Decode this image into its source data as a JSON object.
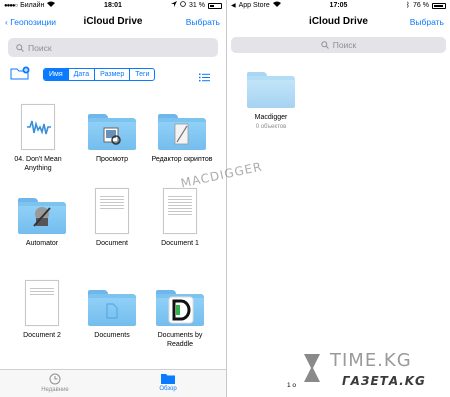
{
  "left": {
    "status": {
      "carrier": "Билайн",
      "time": "18:01",
      "battery": "31 %",
      "battery_level": 0.31
    },
    "nav": {
      "back_label": "Геопозиции",
      "title": "iCloud Drive",
      "action_label": "Выбрать"
    },
    "search": {
      "placeholder": "Поиск"
    },
    "sort": {
      "options": [
        "Имя",
        "Дата",
        "Размер",
        "Теги"
      ],
      "selected": "Имя"
    },
    "items": [
      {
        "label": "04. Don't Mean Anything",
        "kind": "audio"
      },
      {
        "label": "Просмотр",
        "kind": "folder-preview"
      },
      {
        "label": "Редактор скриптов",
        "kind": "folder-script"
      },
      {
        "label": "Automator",
        "kind": "folder-automator"
      },
      {
        "label": "Document",
        "kind": "doc"
      },
      {
        "label": "Document 1",
        "kind": "doc"
      },
      {
        "label": "Document 2",
        "kind": "doc"
      },
      {
        "label": "Documents",
        "kind": "folder-docs"
      },
      {
        "label": "Documents by Readdle",
        "kind": "folder-readdle"
      }
    ],
    "tabs": [
      {
        "label": "Недавние",
        "icon": "clock-icon",
        "active": false
      },
      {
        "label": "Обзор",
        "icon": "folder-icon",
        "active": true
      }
    ]
  },
  "right": {
    "status": {
      "carrier": "App Store",
      "time": "17:05",
      "battery": "76 %",
      "battery_level": 0.76
    },
    "nav": {
      "title": "iCloud Drive",
      "action_label": "Выбрать"
    },
    "search": {
      "placeholder": "Поиск"
    },
    "items": [
      {
        "label": "Macdigger",
        "sub": "0 объектов",
        "kind": "folder"
      }
    ],
    "footer": "1 о"
  },
  "watermarks": {
    "macdigger": "MACDIGGER",
    "time": "TIME.KG",
    "gazeta": "ГАЗЕТА.KG"
  },
  "colors": {
    "accent": "#0a7aff",
    "folder": "#7dc3f0",
    "separator": "#c8c8cc"
  }
}
